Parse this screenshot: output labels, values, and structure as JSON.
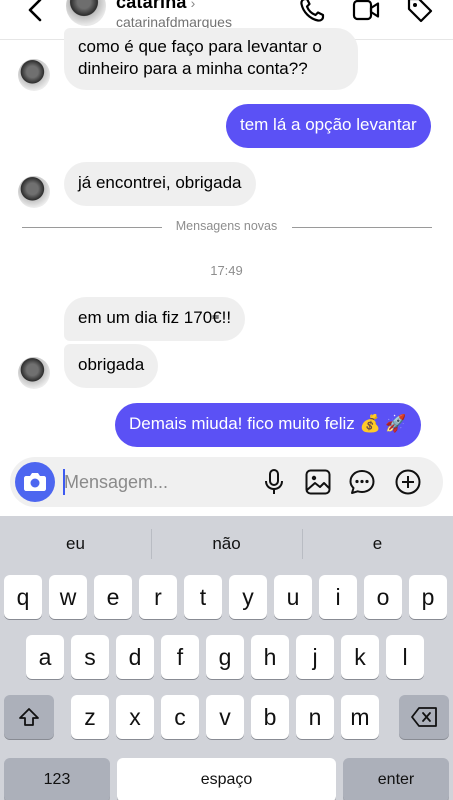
{
  "header": {
    "name": "catarina",
    "chevron": "›",
    "username": "catarinafdmarques",
    "icons": [
      "back-icon",
      "phone-icon",
      "video-icon",
      "tag-icon"
    ]
  },
  "messages": [
    {
      "direction": "in",
      "lines": [
        "como é que faço para levantar o",
        "dinheiro para a minha conta??"
      ]
    },
    {
      "direction": "out",
      "text": "tem lá a opção levantar"
    },
    {
      "direction": "in",
      "text": "já encontrei, obrigada"
    },
    {
      "direction": "in",
      "text": "em um dia fiz 170€!!"
    },
    {
      "direction": "in",
      "text": "obrigada"
    },
    {
      "direction": "out",
      "text": "Demais miuda! fico muito feliz 💰 🚀"
    }
  ],
  "divider_label": "Mensagens novas",
  "timestamp": "17:49",
  "composer": {
    "placeholder": "Mensagem...",
    "icons": [
      "camera-icon",
      "microphone-icon",
      "gallery-icon",
      "sticker-icon",
      "add-icon"
    ]
  },
  "keyboard": {
    "suggestions": [
      "eu",
      "não",
      "e"
    ],
    "row1": [
      "q",
      "w",
      "e",
      "r",
      "t",
      "y",
      "u",
      "i",
      "o",
      "p"
    ],
    "row2": [
      "a",
      "s",
      "d",
      "f",
      "g",
      "h",
      "j",
      "k",
      "l"
    ],
    "row3": [
      "z",
      "x",
      "c",
      "v",
      "b",
      "n",
      "m"
    ],
    "numbers_label": "123",
    "space_label": "espaço",
    "enter_label": "enter"
  },
  "colors": {
    "outgoing_bubble": "#5b51f5",
    "incoming_bubble": "#efefef",
    "camera_button": "#4d66f0",
    "keyboard_bg": "#d1d3d9"
  }
}
